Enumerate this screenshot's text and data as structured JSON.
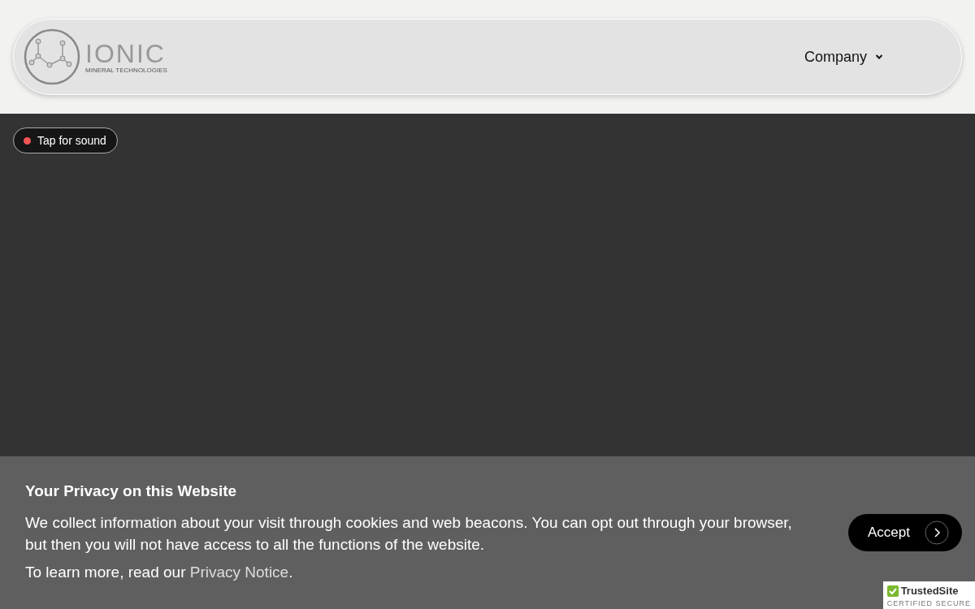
{
  "header": {
    "logo": {
      "name": "IONIC",
      "tagline": "MINERAL TECHNOLOGIES"
    },
    "nav": [
      {
        "label": "Company",
        "has_dropdown": true
      }
    ]
  },
  "video": {
    "sound_button": {
      "label": "Tap for sound",
      "muted": true
    }
  },
  "cookie_banner": {
    "title": "Your Privacy on this Website",
    "body": "We collect information about your visit through cookies and web beacons. You can opt out through your browser, but then you will not have access to all the functions of the website.",
    "learn_more": "To learn more, read our ",
    "link": "Privacy Notice",
    "link_end": ".",
    "accept": "Accept"
  },
  "trust_badge": {
    "name": "TrustedSite",
    "subtitle": "CERTIFIED SECURE"
  }
}
